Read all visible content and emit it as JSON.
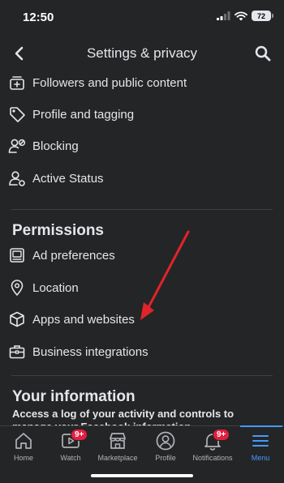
{
  "status_bar": {
    "time": "12:50",
    "battery": "72"
  },
  "header": {
    "title": "Settings & privacy"
  },
  "rows_top": [
    {
      "label": "Followers and public content",
      "icon": "followers-icon"
    },
    {
      "label": "Profile and tagging",
      "icon": "tag-icon"
    },
    {
      "label": "Blocking",
      "icon": "blocking-icon"
    },
    {
      "label": "Active Status",
      "icon": "active-status-icon"
    }
  ],
  "permissions": {
    "title": "Permissions",
    "items": [
      {
        "label": "Ad preferences",
        "icon": "ad-preferences-icon"
      },
      {
        "label": "Location",
        "icon": "location-pin-icon"
      },
      {
        "label": "Apps and websites",
        "icon": "cube-icon"
      },
      {
        "label": "Business integrations",
        "icon": "briefcase-icon"
      }
    ]
  },
  "your_information": {
    "title": "Your information",
    "desc": "Access a log of your activity and controls to manage your Facebook information."
  },
  "tabs": [
    {
      "label": "Home",
      "icon": "home-icon"
    },
    {
      "label": "Watch",
      "icon": "watch-icon",
      "badge": "9+"
    },
    {
      "label": "Marketplace",
      "icon": "marketplace-icon"
    },
    {
      "label": "Profile",
      "icon": "profile-icon"
    },
    {
      "label": "Notifications",
      "icon": "bell-icon",
      "badge": "9+"
    },
    {
      "label": "Menu",
      "icon": "menu-icon",
      "active": true
    }
  ],
  "colors": {
    "background": "#242526",
    "accent": "#4599ff",
    "badge": "#e41e3f",
    "annotation_arrow": "#e0242a"
  }
}
